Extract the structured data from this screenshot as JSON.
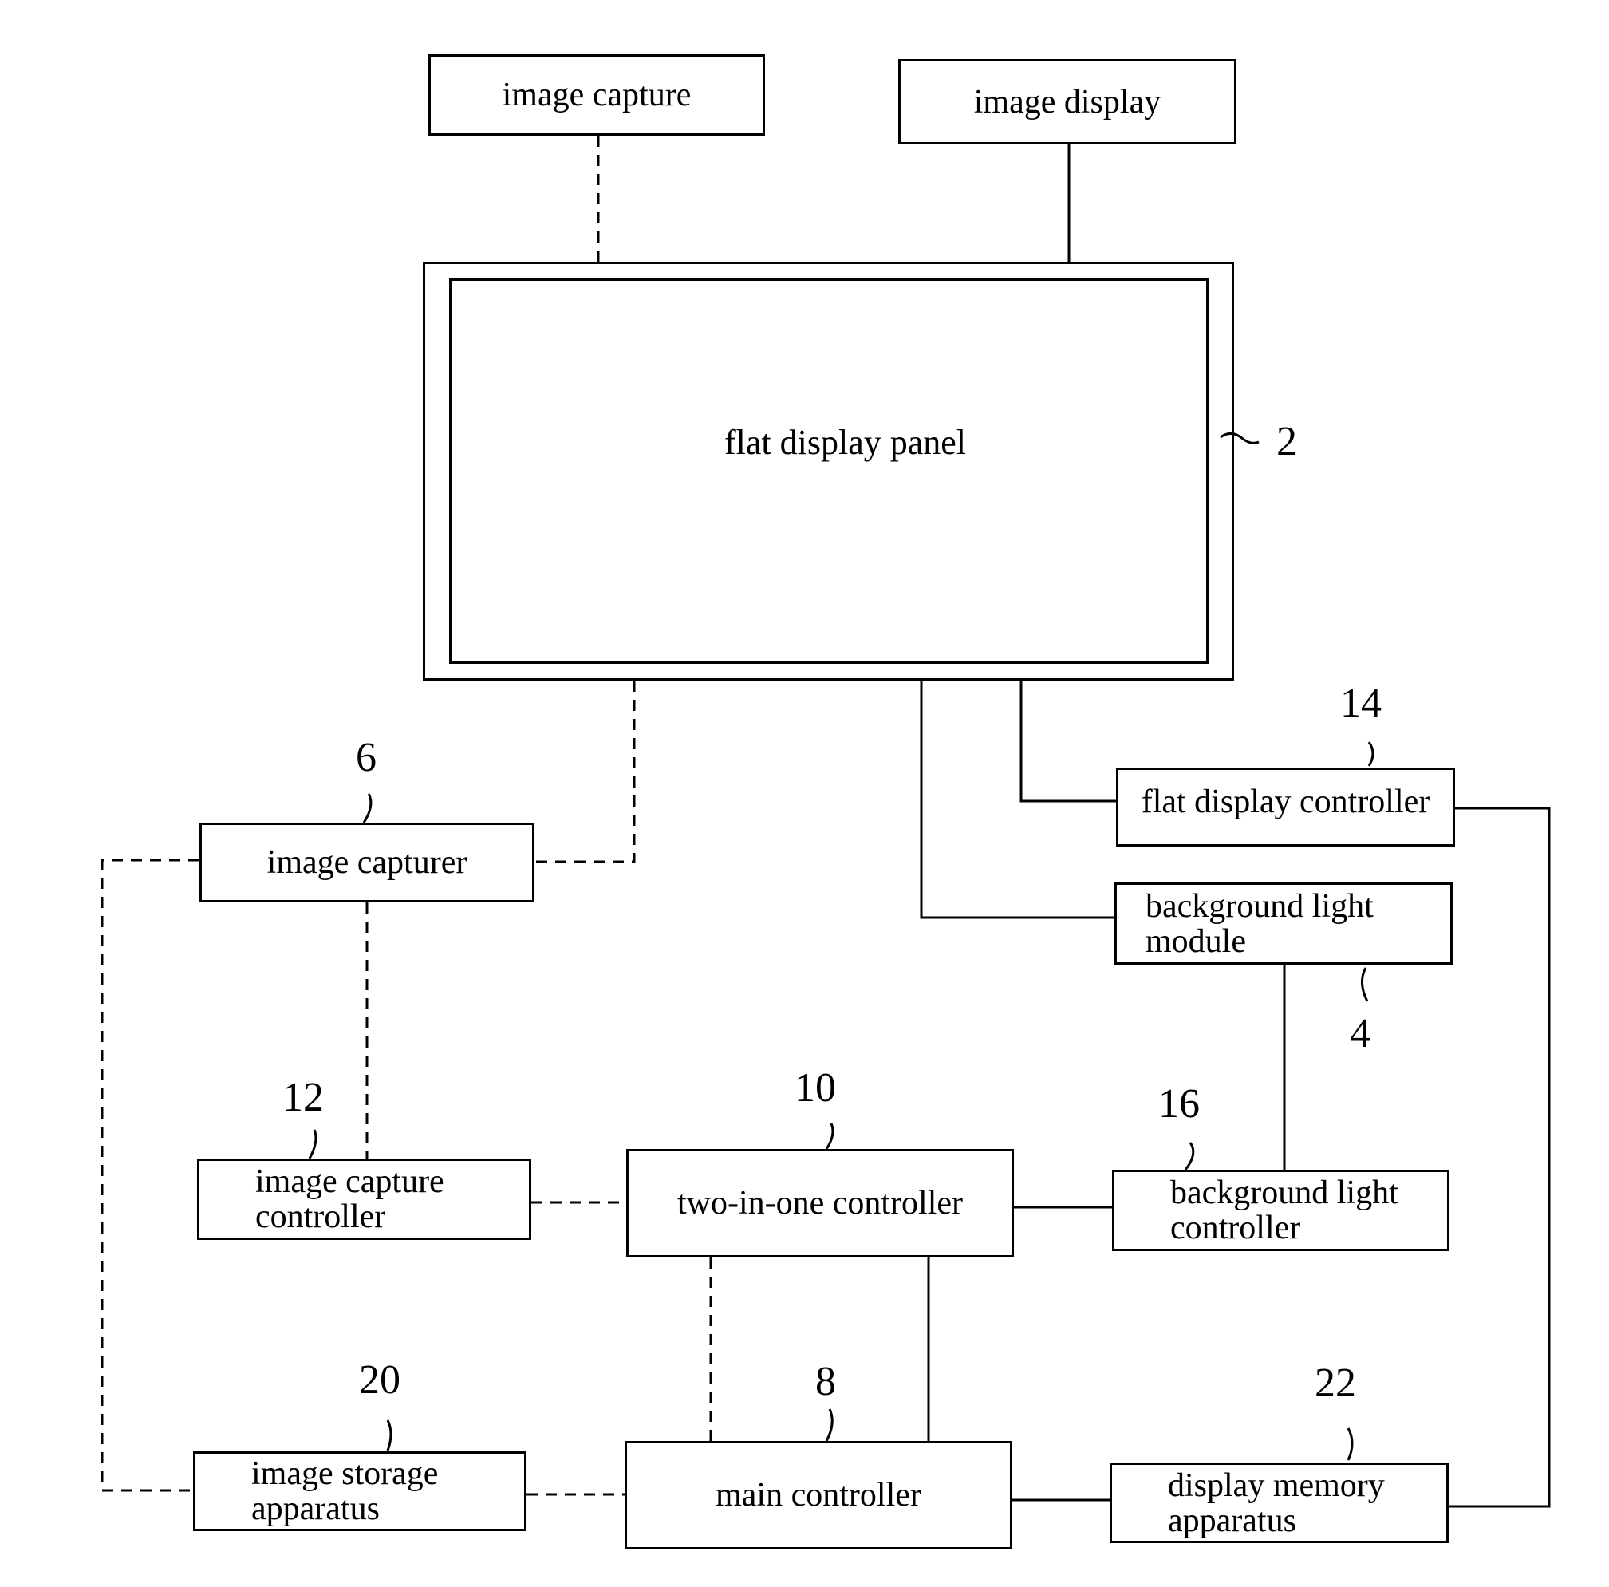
{
  "diagram": {
    "type": "block-diagram",
    "blocks": {
      "image_capture": {
        "label": "image capture"
      },
      "image_display": {
        "label": "image display"
      },
      "flat_display_panel": {
        "label": "flat display panel",
        "ref": "2"
      },
      "flat_display_controller": {
        "label": "flat display controller",
        "ref": "14"
      },
      "background_light_module": {
        "label": "background light\nmodule",
        "ref": "4"
      },
      "image_capturer": {
        "label": "image capturer",
        "ref": "6"
      },
      "image_capture_controller": {
        "label": "image capture\ncontroller",
        "ref": "12"
      },
      "two_in_one_controller": {
        "label": "two-in-one controller",
        "ref": "10"
      },
      "background_light_controller": {
        "label": "background light\ncontroller",
        "ref": "16"
      },
      "image_storage_apparatus": {
        "label": "image storage\napparatus",
        "ref": "20"
      },
      "main_controller": {
        "label": "main controller",
        "ref": "8"
      },
      "display_memory_apparatus": {
        "label": "display memory\napparatus",
        "ref": "22"
      }
    },
    "connections": [
      {
        "from": "image_capture",
        "to": "flat_display_panel",
        "style": "dashed"
      },
      {
        "from": "image_display",
        "to": "flat_display_panel",
        "style": "solid"
      },
      {
        "from": "flat_display_panel",
        "to": "image_capturer",
        "style": "dashed"
      },
      {
        "from": "flat_display_panel",
        "to": "flat_display_controller",
        "style": "solid"
      },
      {
        "from": "flat_display_panel",
        "to": "background_light_module",
        "style": "solid"
      },
      {
        "from": "image_capturer",
        "to": "image_capture_controller",
        "style": "dashed"
      },
      {
        "from": "image_capturer",
        "to": "image_storage_apparatus",
        "style": "dashed"
      },
      {
        "from": "image_capture_controller",
        "to": "two_in_one_controller",
        "style": "dashed"
      },
      {
        "from": "background_light_module",
        "to": "background_light_controller",
        "style": "solid"
      },
      {
        "from": "two_in_one_controller",
        "to": "background_light_controller",
        "style": "solid"
      },
      {
        "from": "two_in_one_controller",
        "to": "main_controller",
        "style": "dashed"
      },
      {
        "from": "two_in_one_controller",
        "to": "main_controller",
        "style": "solid"
      },
      {
        "from": "image_storage_apparatus",
        "to": "main_controller",
        "style": "dashed"
      },
      {
        "from": "main_controller",
        "to": "display_memory_apparatus",
        "style": "solid"
      },
      {
        "from": "flat_display_controller",
        "to": "display_memory_apparatus",
        "style": "solid"
      }
    ]
  }
}
